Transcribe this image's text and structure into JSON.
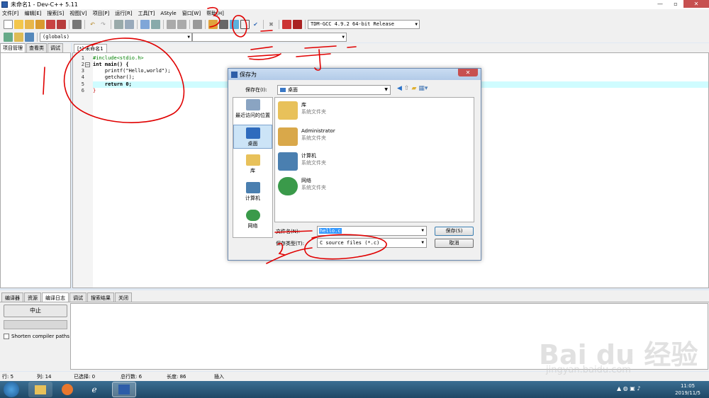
{
  "window": {
    "title": "未命名1 - Dev-C++ 5.11",
    "controls": [
      "—",
      "▫",
      "✕"
    ]
  },
  "menu": [
    "文件[F]",
    "编辑[E]",
    "搜索[S]",
    "视图[V]",
    "项目[P]",
    "运行[R]",
    "工具[T]",
    "AStyle",
    "窗口[W]",
    "帮助[H]"
  ],
  "toolbar": {
    "compiler": "TDM-GCC 4.9.2 64-bit Release",
    "scope": "(globals)"
  },
  "left_tabs": [
    "项目管理",
    "查看类",
    "调试"
  ],
  "editor": {
    "tab": "[*] 未命名1",
    "lines": [
      {
        "num": "1",
        "text": "#include<stdio.h>"
      },
      {
        "num": "2",
        "text": "int main() {"
      },
      {
        "num": "3",
        "text": "    printf(\"Hello,world\");"
      },
      {
        "num": "4",
        "text": "    getchar();"
      },
      {
        "num": "5",
        "text": "    return 0;"
      },
      {
        "num": "6",
        "text": "}"
      }
    ]
  },
  "bottom_tabs": [
    "编译器",
    "资源",
    "编译日志",
    "调试",
    "搜索结果",
    "关闭"
  ],
  "bottom_panel": {
    "stop_label": "中止",
    "shorten_label": "Shorten compiler paths"
  },
  "status": {
    "row": "行:    5",
    "col": "列:    14",
    "selected": "已选择:    0",
    "total": "总行数:    6",
    "length": "长度:    86",
    "mode": "插入"
  },
  "dialog": {
    "title": "保存为",
    "save_in_label": "保存在(I):",
    "save_in_value": "桌面",
    "places": [
      "最近访问的位置",
      "桌面",
      "库",
      "计算机",
      "网络"
    ],
    "items": [
      {
        "name": "库",
        "sub": "系统文件夹"
      },
      {
        "name": "Administrator",
        "sub": "系统文件夹"
      },
      {
        "name": "计算机",
        "sub": "系统文件夹"
      },
      {
        "name": "网络",
        "sub": "系统文件夹"
      }
    ],
    "filename_label": "文件名(N):",
    "filename_value": "hello.c",
    "filetype_label": "保存类型(T):",
    "filetype_value": "C source files (*.c)",
    "save_button": "保存(S)",
    "cancel_button": "取消"
  },
  "taskbar": {
    "time": "11:05",
    "date": "2019/11/5"
  },
  "watermark": {
    "main": "Bai du 经验",
    "sub": "jingyan.baidu.com"
  },
  "annotations": {
    "num1": "1",
    "num2": "2",
    "num3": "3",
    "text_run": "运行"
  },
  "colors": {
    "keyword": "#000000",
    "preprocessor": "#008000",
    "string": "#0000c8",
    "symbol": "#c00000",
    "annotation": "#e00000"
  }
}
